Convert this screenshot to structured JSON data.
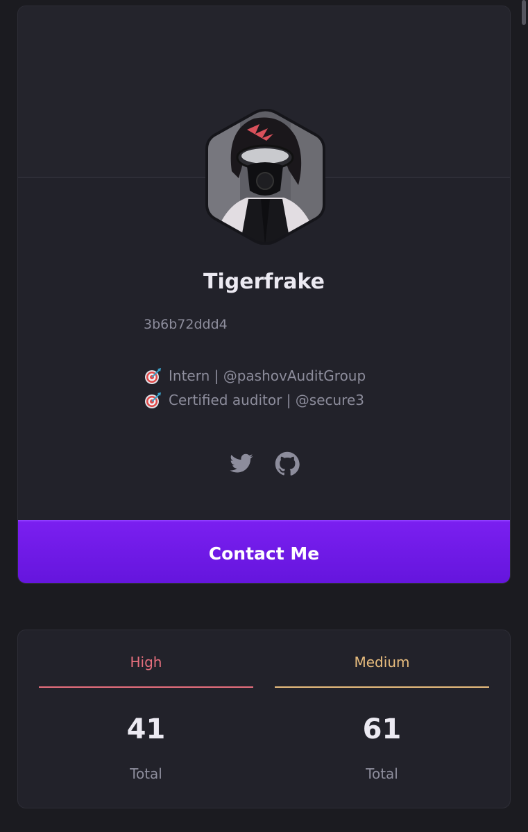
{
  "profile": {
    "name": "Tigerfrake",
    "hash": "3b6b72ddd4",
    "bio": [
      {
        "icon": "target-icon",
        "text": "Intern | @pashovAuditGroup"
      },
      {
        "icon": "target-icon",
        "text": "Certified auditor | @secure3"
      }
    ],
    "socials": [
      "twitter-icon",
      "github-icon"
    ],
    "contact_label": "Contact Me",
    "accent_color": "#7a1ff0"
  },
  "stats": {
    "high": {
      "label": "High",
      "value": "41",
      "sub": "Total",
      "color": "#e8707e"
    },
    "medium": {
      "label": "Medium",
      "value": "61",
      "sub": "Total",
      "color": "#e9bd7e"
    }
  }
}
